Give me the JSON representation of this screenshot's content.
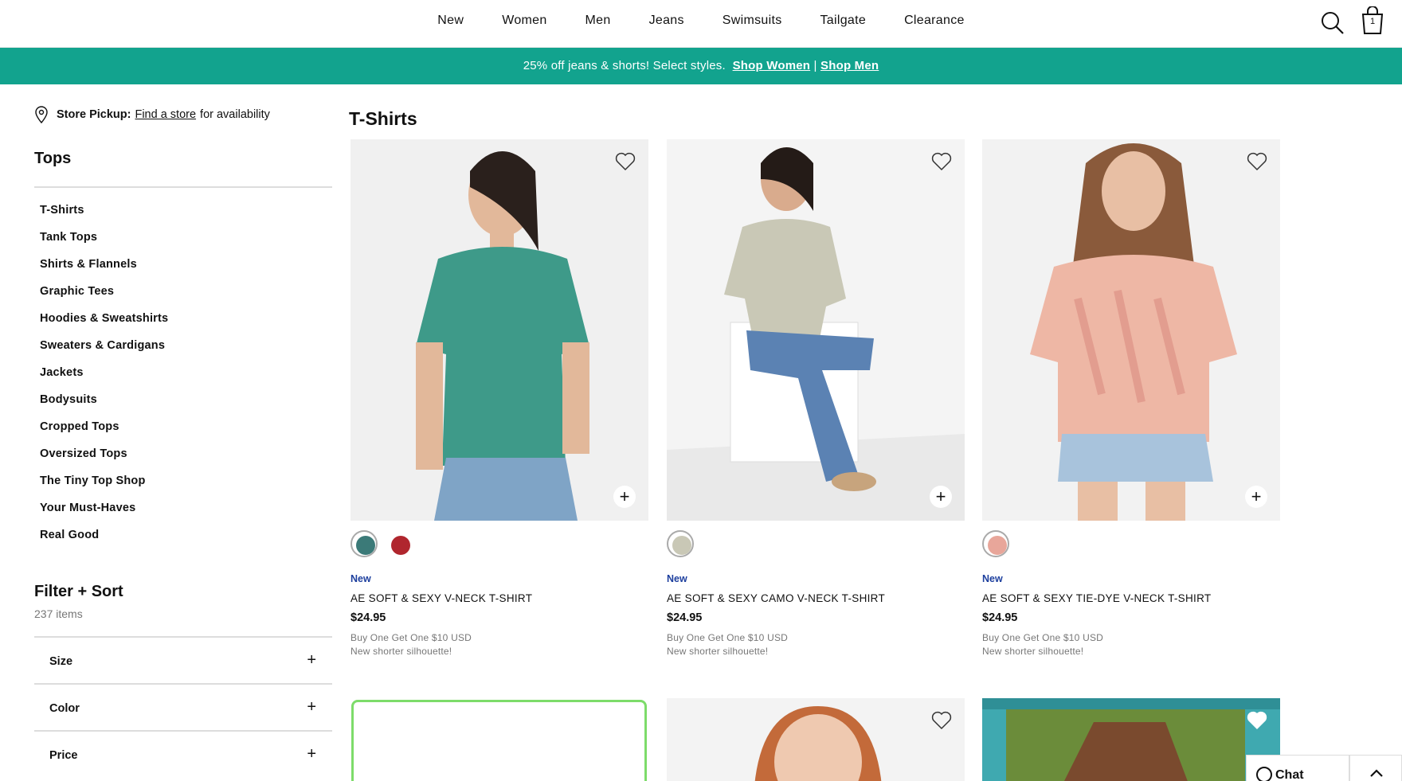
{
  "nav": {
    "links": [
      "New",
      "Women",
      "Men",
      "Jeans",
      "Swimsuits",
      "Tailgate",
      "Clearance"
    ],
    "bag_count": "1",
    "search_icon": "search-icon",
    "bag_icon": "shopping-bag-icon"
  },
  "promo": {
    "text": "25% off jeans & shorts! Select styles.",
    "link_women": "Shop Women",
    "separator": "|",
    "link_men": "Shop Men",
    "color": "#12a38e"
  },
  "sidebar": {
    "store_label": "Store Pickup:",
    "store_link": "Find a store",
    "store_suffix": "for availability",
    "title": "Tops",
    "categories": [
      "T-Shirts",
      "Tank Tops",
      "Shirts & Flannels",
      "Graphic Tees",
      "Hoodies & Sweatshirts",
      "Sweaters & Cardigans",
      "Jackets",
      "Bodysuits",
      "Cropped Tops",
      "Oversized Tops",
      "The Tiny Top Shop",
      "Your Must-Haves",
      "Real Good"
    ],
    "filter_title": "Filter + Sort",
    "item_count": "237 items",
    "filters": [
      "Size",
      "Color",
      "Price"
    ]
  },
  "main": {
    "title": "T-Shirts",
    "products": [
      {
        "badge": "New",
        "name": "AE SOFT & SEXY V-NECK T-SHIRT",
        "price": "$24.95",
        "promo": "Buy One Get One $10 USD",
        "note": "New shorter silhouette!",
        "swatches": [
          "#3b7a78",
          "#b0262e"
        ]
      },
      {
        "badge": "New",
        "name": "AE SOFT & SEXY CAMO V-NECK T-SHIRT",
        "price": "$24.95",
        "promo": "Buy One Get One $10 USD",
        "note": "New shorter silhouette!",
        "swatches": [
          "#c9c8b6"
        ]
      },
      {
        "badge": "New",
        "name": "AE SOFT & SEXY TIE-DYE V-NECK T-SHIRT",
        "price": "$24.95",
        "promo": "Buy One Get One $10 USD",
        "note": "New shorter silhouette!",
        "swatches": [
          "#e8a69a"
        ]
      }
    ]
  },
  "widgets": {
    "chat_label": "Chat"
  }
}
